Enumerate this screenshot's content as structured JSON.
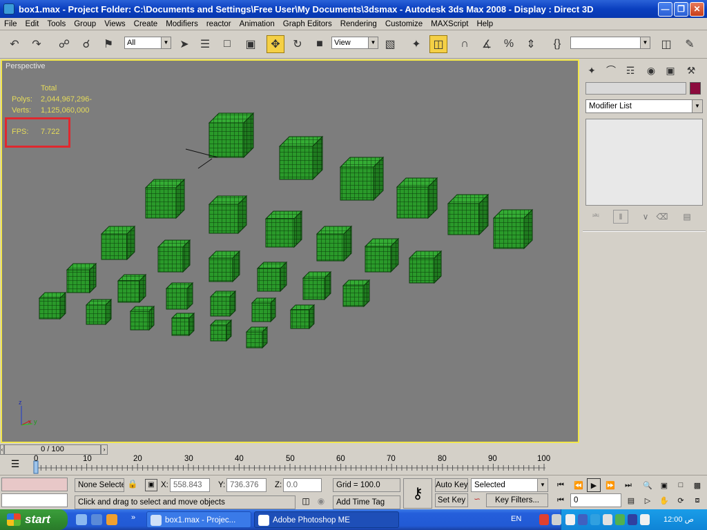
{
  "window": {
    "title": "box1.max    - Project Folder: C:\\Documents and Settings\\Free User\\My Documents\\3dsmax      - Autodesk 3ds Max 2008       - Display : Direct 3D"
  },
  "menu": [
    "File",
    "Edit",
    "Tools",
    "Group",
    "Views",
    "Create",
    "Modifiers",
    "reactor",
    "Animation",
    "Graph Editors",
    "Rendering",
    "Customize",
    "MAXScript",
    "Help"
  ],
  "toolbar": {
    "selection_filter": "All",
    "reference_coord": "View",
    "named_selection": ""
  },
  "viewport": {
    "label": "Perspective",
    "stats": {
      "header": "Total",
      "polys_label": "Polys:",
      "polys_value": "2,044,967,296-",
      "verts_label": "Verts:",
      "verts_value": "1,125,060,000",
      "fps_label": "FPS:",
      "fps_value": "7.722"
    },
    "axis": {
      "z": "z",
      "x": "x",
      "y": "y"
    }
  },
  "command_panel": {
    "modifier_list": "Modifier List"
  },
  "timeline": {
    "frame_display": "0 / 100",
    "ticks": [
      "0",
      "10",
      "20",
      "30",
      "40",
      "50",
      "60",
      "70",
      "80",
      "90",
      "100"
    ]
  },
  "status": {
    "selection": "None Selecte",
    "x_label": "X:",
    "x_value": "558.843",
    "y_label": "Y:",
    "y_value": "736.376",
    "z_label": "Z:",
    "z_value": "0.0",
    "grid": "Grid = 100.0",
    "prompt": "Click and drag to select and move objects",
    "add_time_tag": "Add Time Tag",
    "auto_key": "Auto Key",
    "set_key": "Set Key",
    "key_mode": "Selected",
    "key_filters": "Key Filters...",
    "current_frame": "0"
  },
  "taskbar": {
    "start": "start",
    "tasks": [
      "box1.max    - Projec...",
      "Adobe Photoshop ME"
    ],
    "language": "EN",
    "clock": "12:00 ص"
  }
}
